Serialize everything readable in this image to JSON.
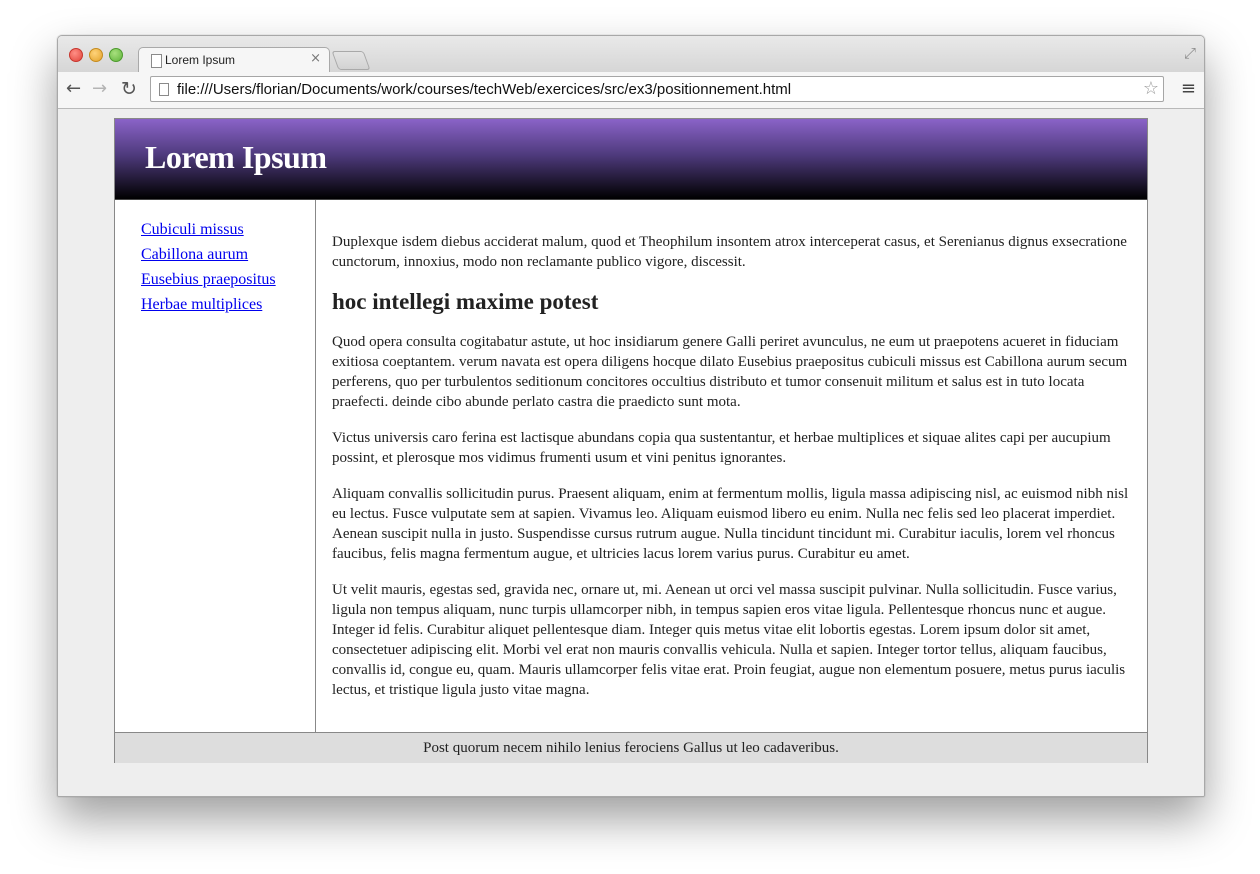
{
  "browser": {
    "tab_title": "Lorem Ipsum",
    "tab_close": "×",
    "url": "file:///Users/florian/Documents/work/courses/techWeb/exercices/src/ex3/positionnement.html",
    "back_glyph": "←",
    "forward_glyph": "→",
    "reload_glyph": "↻",
    "star_glyph": "☆",
    "menu_glyph": "≡",
    "fullscreen_glyph": "⤢"
  },
  "site": {
    "title": "Lorem Ipsum",
    "nav": [
      {
        "label": "Cubiculi missus"
      },
      {
        "label": "Cabillona aurum"
      },
      {
        "label": "Eusebius praepositus"
      },
      {
        "label": "Herbae multiplices"
      }
    ],
    "intro": "Duplexque isdem diebus acciderat malum, quod et Theophilum insontem atrox interceperat casus, et Serenianus dignus exsecratione cunctorum, innoxius, modo non reclamante publico vigore, discessit.",
    "heading": "hoc intellegi maxime potest",
    "paragraphs": [
      "Quod opera consulta cogitabatur astute, ut hoc insidiarum genere Galli periret avunculus, ne eum ut praepotens acueret in fiduciam exitiosa coeptantem. verum navata est opera diligens hocque dilato Eusebius praepositus cubiculi missus est Cabillona aurum secum perferens, quo per turbulentos seditionum concitores occultius distributo et tumor consenuit militum et salus est in tuto locata praefecti. deinde cibo abunde perlato castra die praedicto sunt mota.",
      "Victus universis caro ferina est lactisque abundans copia qua sustentantur, et herbae multiplices et siquae alites capi per aucupium possint, et plerosque mos vidimus frumenti usum et vini penitus ignorantes.",
      "Aliquam convallis sollicitudin purus. Praesent aliquam, enim at fermentum mollis, ligula massa adipiscing nisl, ac euismod nibh nisl eu lectus. Fusce vulputate sem at sapien. Vivamus leo. Aliquam euismod libero eu enim. Nulla nec felis sed leo placerat imperdiet. Aenean suscipit nulla in justo. Suspendisse cursus rutrum augue. Nulla tincidunt tincidunt mi. Curabitur iaculis, lorem vel rhoncus faucibus, felis magna fermentum augue, et ultricies lacus lorem varius purus. Curabitur eu amet.",
      "Ut velit mauris, egestas sed, gravida nec, ornare ut, mi. Aenean ut orci vel massa suscipit pulvinar. Nulla sollicitudin. Fusce varius, ligula non tempus aliquam, nunc turpis ullamcorper nibh, in tempus sapien eros vitae ligula. Pellentesque rhoncus nunc et augue. Integer id felis. Curabitur aliquet pellentesque diam. Integer quis metus vitae elit lobortis egestas. Lorem ipsum dolor sit amet, consectetuer adipiscing elit. Morbi vel erat non mauris convallis vehicula. Nulla et sapien. Integer tortor tellus, aliquam faucibus, convallis id, congue eu, quam. Mauris ullamcorper felis vitae erat. Proin feugiat, augue non elementum posuere, metus purus iaculis lectus, et tristique ligula justo vitae magna."
    ],
    "footer": "Post quorum necem nihilo lenius ferociens Gallus ut leo cadaveribus."
  },
  "colors": {
    "header_top": "#8a63c8",
    "header_bottom": "#000000",
    "link": "#0000ee",
    "footer_bg": "#dddddd"
  }
}
